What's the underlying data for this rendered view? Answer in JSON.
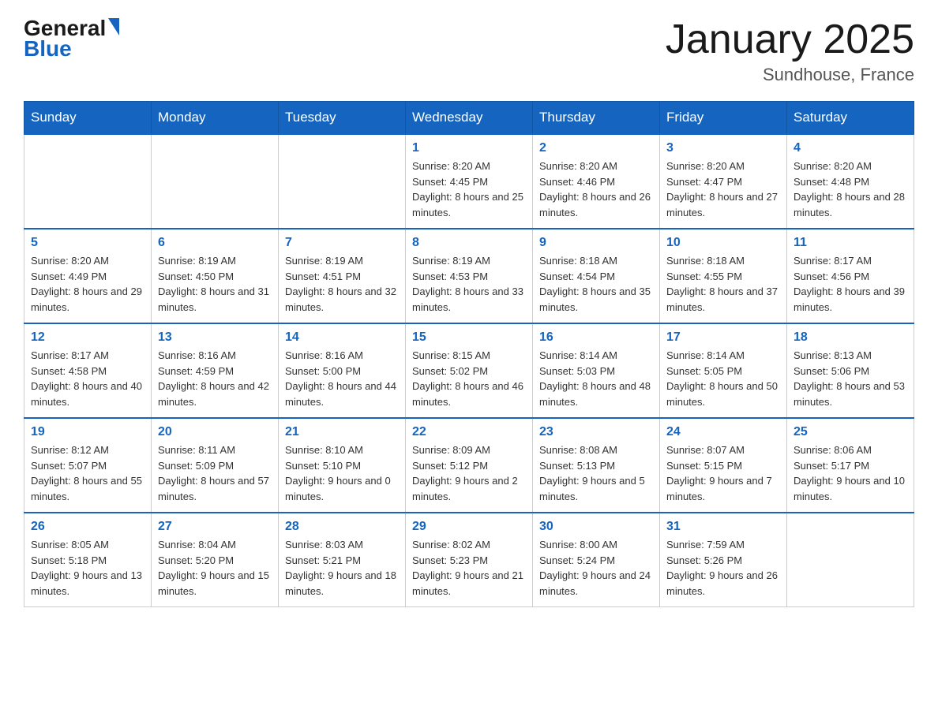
{
  "header": {
    "logo_general": "General",
    "logo_blue": "Blue",
    "title": "January 2025",
    "subtitle": "Sundhouse, France"
  },
  "days_of_week": [
    "Sunday",
    "Monday",
    "Tuesday",
    "Wednesday",
    "Thursday",
    "Friday",
    "Saturday"
  ],
  "weeks": [
    [
      {
        "day": "",
        "info": ""
      },
      {
        "day": "",
        "info": ""
      },
      {
        "day": "",
        "info": ""
      },
      {
        "day": "1",
        "info": "Sunrise: 8:20 AM\nSunset: 4:45 PM\nDaylight: 8 hours\nand 25 minutes."
      },
      {
        "day": "2",
        "info": "Sunrise: 8:20 AM\nSunset: 4:46 PM\nDaylight: 8 hours\nand 26 minutes."
      },
      {
        "day": "3",
        "info": "Sunrise: 8:20 AM\nSunset: 4:47 PM\nDaylight: 8 hours\nand 27 minutes."
      },
      {
        "day": "4",
        "info": "Sunrise: 8:20 AM\nSunset: 4:48 PM\nDaylight: 8 hours\nand 28 minutes."
      }
    ],
    [
      {
        "day": "5",
        "info": "Sunrise: 8:20 AM\nSunset: 4:49 PM\nDaylight: 8 hours\nand 29 minutes."
      },
      {
        "day": "6",
        "info": "Sunrise: 8:19 AM\nSunset: 4:50 PM\nDaylight: 8 hours\nand 31 minutes."
      },
      {
        "day": "7",
        "info": "Sunrise: 8:19 AM\nSunset: 4:51 PM\nDaylight: 8 hours\nand 32 minutes."
      },
      {
        "day": "8",
        "info": "Sunrise: 8:19 AM\nSunset: 4:53 PM\nDaylight: 8 hours\nand 33 minutes."
      },
      {
        "day": "9",
        "info": "Sunrise: 8:18 AM\nSunset: 4:54 PM\nDaylight: 8 hours\nand 35 minutes."
      },
      {
        "day": "10",
        "info": "Sunrise: 8:18 AM\nSunset: 4:55 PM\nDaylight: 8 hours\nand 37 minutes."
      },
      {
        "day": "11",
        "info": "Sunrise: 8:17 AM\nSunset: 4:56 PM\nDaylight: 8 hours\nand 39 minutes."
      }
    ],
    [
      {
        "day": "12",
        "info": "Sunrise: 8:17 AM\nSunset: 4:58 PM\nDaylight: 8 hours\nand 40 minutes."
      },
      {
        "day": "13",
        "info": "Sunrise: 8:16 AM\nSunset: 4:59 PM\nDaylight: 8 hours\nand 42 minutes."
      },
      {
        "day": "14",
        "info": "Sunrise: 8:16 AM\nSunset: 5:00 PM\nDaylight: 8 hours\nand 44 minutes."
      },
      {
        "day": "15",
        "info": "Sunrise: 8:15 AM\nSunset: 5:02 PM\nDaylight: 8 hours\nand 46 minutes."
      },
      {
        "day": "16",
        "info": "Sunrise: 8:14 AM\nSunset: 5:03 PM\nDaylight: 8 hours\nand 48 minutes."
      },
      {
        "day": "17",
        "info": "Sunrise: 8:14 AM\nSunset: 5:05 PM\nDaylight: 8 hours\nand 50 minutes."
      },
      {
        "day": "18",
        "info": "Sunrise: 8:13 AM\nSunset: 5:06 PM\nDaylight: 8 hours\nand 53 minutes."
      }
    ],
    [
      {
        "day": "19",
        "info": "Sunrise: 8:12 AM\nSunset: 5:07 PM\nDaylight: 8 hours\nand 55 minutes."
      },
      {
        "day": "20",
        "info": "Sunrise: 8:11 AM\nSunset: 5:09 PM\nDaylight: 8 hours\nand 57 minutes."
      },
      {
        "day": "21",
        "info": "Sunrise: 8:10 AM\nSunset: 5:10 PM\nDaylight: 9 hours\nand 0 minutes."
      },
      {
        "day": "22",
        "info": "Sunrise: 8:09 AM\nSunset: 5:12 PM\nDaylight: 9 hours\nand 2 minutes."
      },
      {
        "day": "23",
        "info": "Sunrise: 8:08 AM\nSunset: 5:13 PM\nDaylight: 9 hours\nand 5 minutes."
      },
      {
        "day": "24",
        "info": "Sunrise: 8:07 AM\nSunset: 5:15 PM\nDaylight: 9 hours\nand 7 minutes."
      },
      {
        "day": "25",
        "info": "Sunrise: 8:06 AM\nSunset: 5:17 PM\nDaylight: 9 hours\nand 10 minutes."
      }
    ],
    [
      {
        "day": "26",
        "info": "Sunrise: 8:05 AM\nSunset: 5:18 PM\nDaylight: 9 hours\nand 13 minutes."
      },
      {
        "day": "27",
        "info": "Sunrise: 8:04 AM\nSunset: 5:20 PM\nDaylight: 9 hours\nand 15 minutes."
      },
      {
        "day": "28",
        "info": "Sunrise: 8:03 AM\nSunset: 5:21 PM\nDaylight: 9 hours\nand 18 minutes."
      },
      {
        "day": "29",
        "info": "Sunrise: 8:02 AM\nSunset: 5:23 PM\nDaylight: 9 hours\nand 21 minutes."
      },
      {
        "day": "30",
        "info": "Sunrise: 8:00 AM\nSunset: 5:24 PM\nDaylight: 9 hours\nand 24 minutes."
      },
      {
        "day": "31",
        "info": "Sunrise: 7:59 AM\nSunset: 5:26 PM\nDaylight: 9 hours\nand 26 minutes."
      },
      {
        "day": "",
        "info": ""
      }
    ]
  ]
}
